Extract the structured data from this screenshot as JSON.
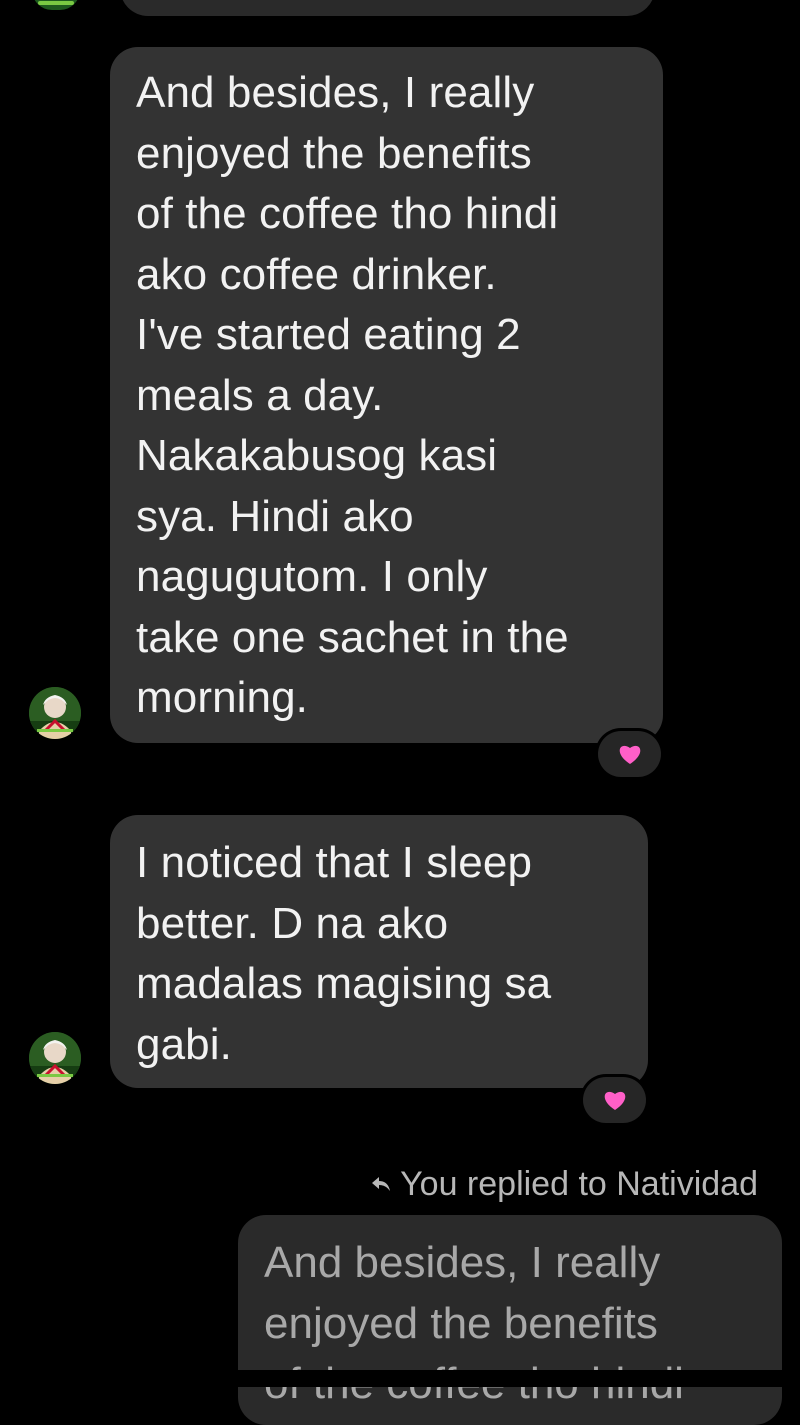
{
  "conversation": {
    "messages": [
      {
        "sender": "Natividad",
        "text": "And besides, I really\nenjoyed the benefits\nof the coffee tho hindi\nako coffee drinker.\nI've started eating 2\nmeals a day.\nNakakabusog kasi\nsya. Hindi ako\nnagugutom. I only\ntake one sachet in the\nmorning.",
        "reaction": "heart-icon"
      },
      {
        "sender": "Natividad",
        "text": "I noticed that I sleep\nbetter. D na ako\nmadalas magising sa\ngabi.",
        "reaction": "heart-icon"
      }
    ],
    "reply": {
      "label": "You replied to Natividad",
      "quoted_text": "And besides, I really\nenjoyed the benefits\nof the coffee tho hindi"
    }
  },
  "colors": {
    "background": "#000000",
    "incoming_bubble": "#333333",
    "quoted_bubble": "#2a2a2a",
    "text_primary": "#f2f2f2",
    "text_secondary": "#b7b7b7",
    "reaction_heart": "#ff5fc8"
  }
}
